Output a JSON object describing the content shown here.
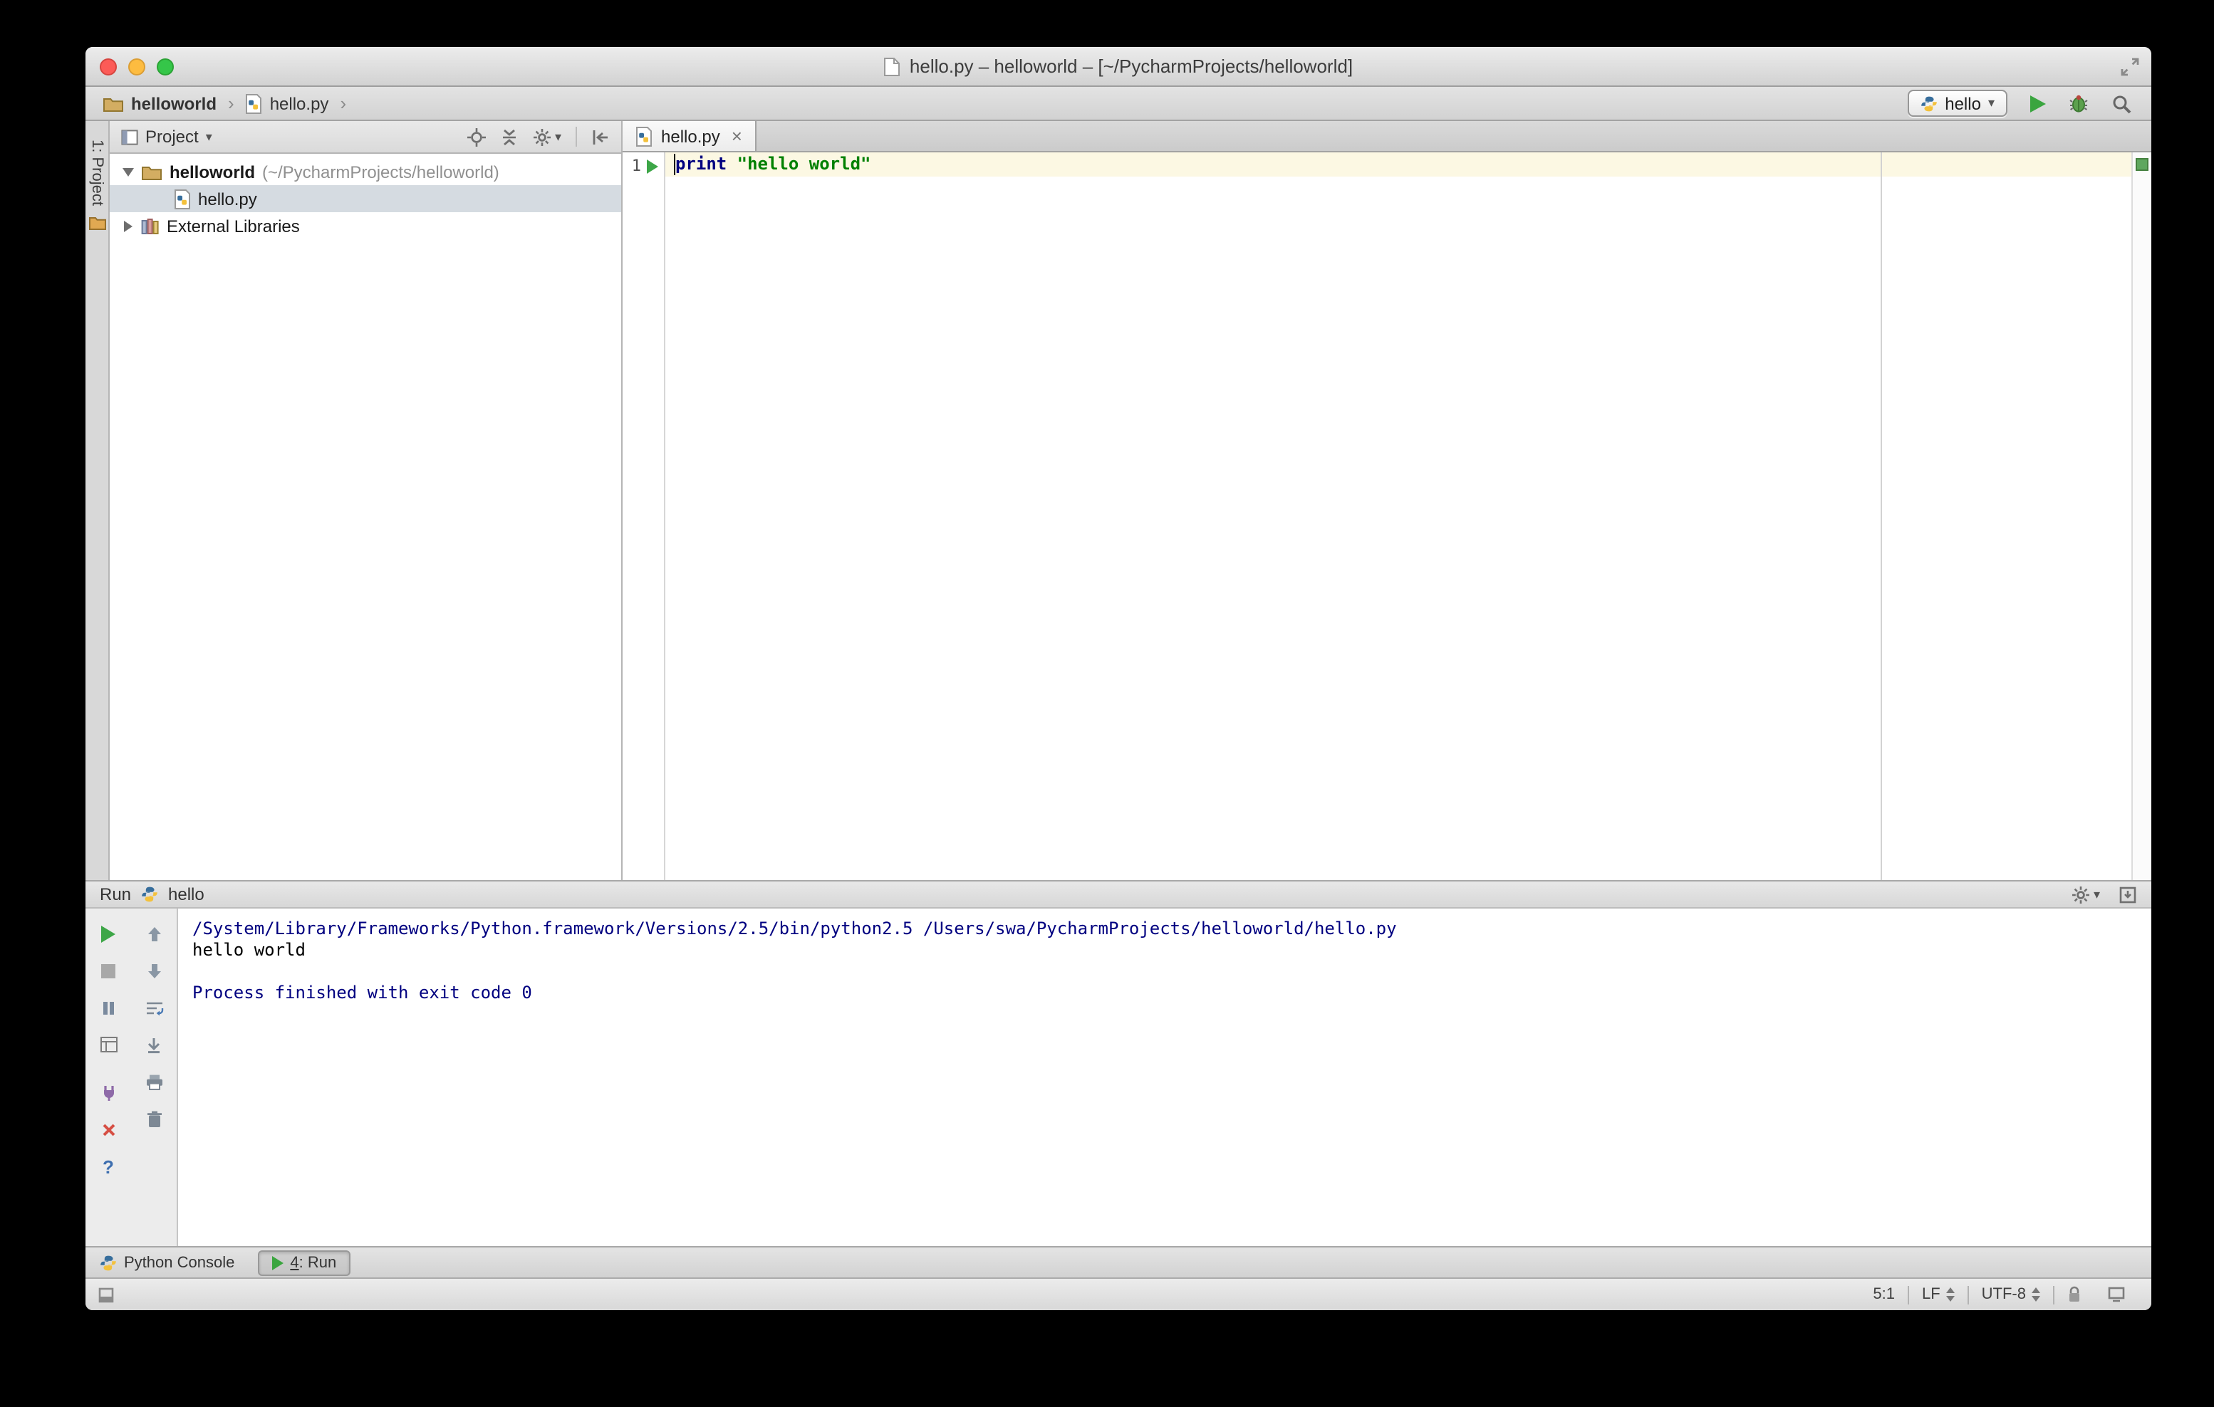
{
  "window": {
    "title": "hello.py – helloworld – [~/PycharmProjects/helloworld]"
  },
  "navbar": {
    "breadcrumbs": [
      {
        "label": "helloworld"
      },
      {
        "label": "hello.py"
      }
    ],
    "run_config": "hello"
  },
  "tool_stripe": {
    "project_tab": "1: Project"
  },
  "project": {
    "header": "Project",
    "tree": [
      {
        "label": "helloworld",
        "detail": "(~/PycharmProjects/helloworld)"
      },
      {
        "label": "hello.py"
      },
      {
        "label": "External Libraries"
      }
    ]
  },
  "editor": {
    "tab": "hello.py",
    "line_number": "1",
    "keyword": "print",
    "string": "\"hello world\""
  },
  "run": {
    "title": "Run",
    "config": "hello",
    "lines": [
      {
        "text": "/System/Library/Frameworks/Python.framework/Versions/2.5/bin/python2.5 /Users/swa/PycharmProjects/helloworld/hello.py"
      },
      {
        "text": "hello world"
      },
      {
        "text": ""
      },
      {
        "text": "Process finished with exit code 0"
      }
    ]
  },
  "bottom": {
    "python_console": "Python Console",
    "run_tab_number": "4",
    "run_tab_suffix": ": Run"
  },
  "status": {
    "caret": "5:1",
    "line_sep": "LF",
    "encoding": "UTF-8"
  },
  "icons": {
    "chevron": "›",
    "dropdown": "▾",
    "close": "×",
    "help": "?"
  }
}
